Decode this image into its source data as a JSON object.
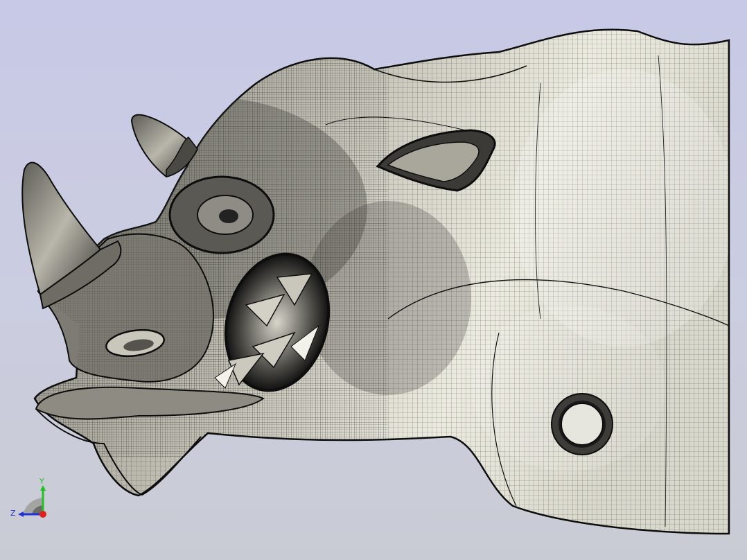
{
  "viewport": {
    "background_top": "#c8c9e6",
    "background_bottom": "#c9cbd4",
    "model_name": "rhino-head-mesh",
    "display_mode": "shaded-with-edges"
  },
  "colors": {
    "surface_light": "#ecebdf",
    "surface_mid": "#bdbbae",
    "surface_dark": "#6f6e66",
    "edge": "#111111",
    "axis_x": "#e0201c",
    "axis_y": "#1fc21f",
    "axis_z": "#2233d6"
  },
  "triad": {
    "y_label": "Y",
    "z_label": "Z"
  }
}
